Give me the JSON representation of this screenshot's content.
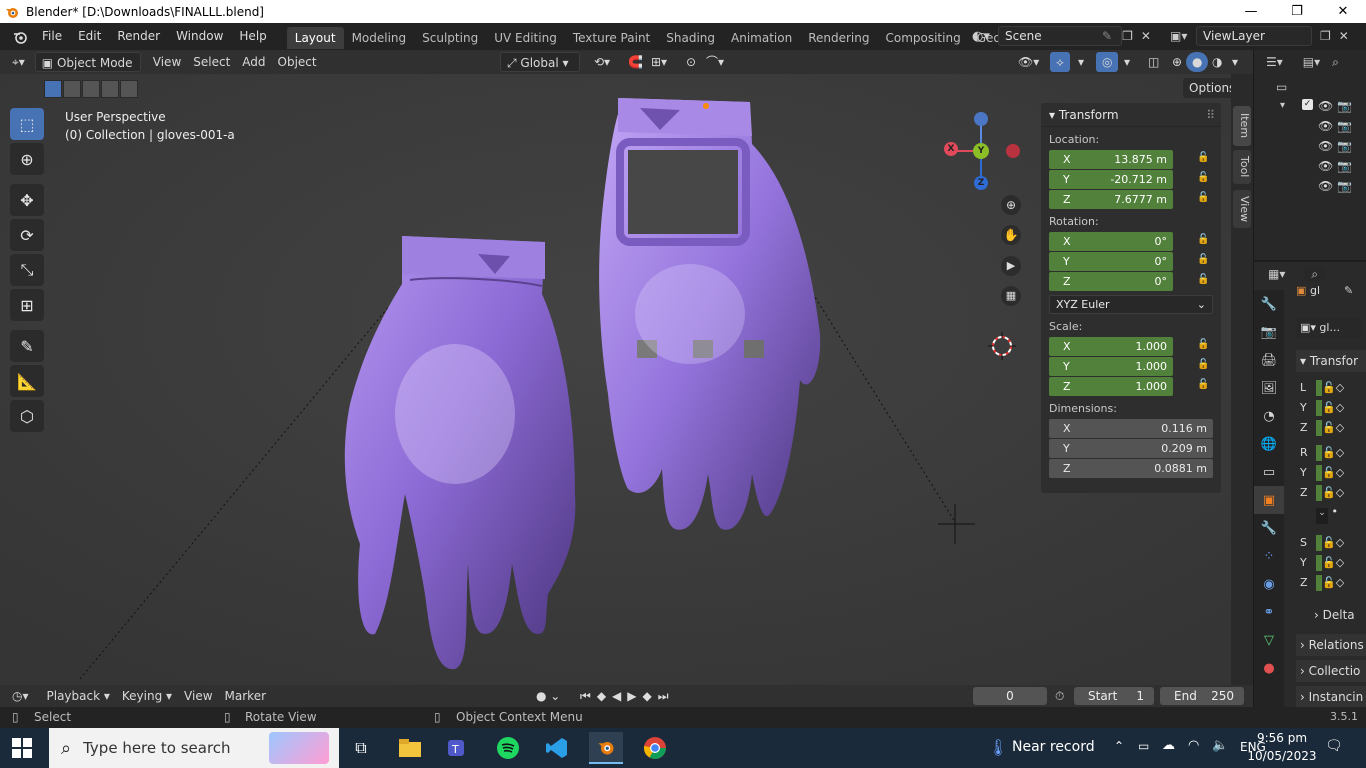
{
  "window": {
    "title": "Blender* [D:\\Downloads\\FINALLL.blend]",
    "minimize": "—",
    "maximize": "❐",
    "close": "✕"
  },
  "menubar": {
    "items": [
      "File",
      "Edit",
      "Render",
      "Window",
      "Help"
    ],
    "workspaces": [
      "Layout",
      "Modeling",
      "Sculpting",
      "UV Editing",
      "Texture Paint",
      "Shading",
      "Animation",
      "Rendering",
      "Compositing",
      "Geometry Noc"
    ],
    "active_workspace": "Layout",
    "scene": "Scene",
    "view_layer": "ViewLayer"
  },
  "viewport_header": {
    "mode": "Object Mode",
    "menus": [
      "View",
      "Select",
      "Add",
      "Object"
    ],
    "orientation": "Global",
    "options": "Options"
  },
  "viewport": {
    "info_line1": "User Perspective",
    "info_line2": "(0) Collection | gloves-001-a",
    "background": "#3d3d3d",
    "glove_color": "#8a6ad0"
  },
  "gizmo": {
    "x": "X",
    "y": "Y",
    "z": "Z"
  },
  "transform_panel": {
    "title": "Transform",
    "location_label": "Location:",
    "location": [
      {
        "axis": "X",
        "value": "13.875 m"
      },
      {
        "axis": "Y",
        "value": "-20.712 m"
      },
      {
        "axis": "Z",
        "value": "7.6777 m"
      }
    ],
    "rotation_label": "Rotation:",
    "rotation": [
      {
        "axis": "X",
        "value": "0°"
      },
      {
        "axis": "Y",
        "value": "0°"
      },
      {
        "axis": "Z",
        "value": "0°"
      }
    ],
    "rotation_mode": "XYZ Euler",
    "scale_label": "Scale:",
    "scale": [
      {
        "axis": "X",
        "value": "1.000"
      },
      {
        "axis": "Y",
        "value": "1.000"
      },
      {
        "axis": "Z",
        "value": "1.000"
      }
    ],
    "dimensions_label": "Dimensions:",
    "dimensions": [
      {
        "axis": "X",
        "value": "0.116 m"
      },
      {
        "axis": "Y",
        "value": "0.209 m"
      },
      {
        "axis": "Z",
        "value": "0.0881 m"
      }
    ]
  },
  "side_tabs": [
    "Item",
    "Tool",
    "View"
  ],
  "properties": {
    "search_value": "gl",
    "object_name": "gl...",
    "section": "Transfor",
    "rows": [
      "L",
      "Y",
      "Z",
      "R",
      "Y",
      "Z",
      "S",
      "Y",
      "Z"
    ],
    "subsections": [
      "Delta",
      "Relations",
      "Collectio",
      "Instancin"
    ]
  },
  "timeline": {
    "menus": [
      "Playback",
      "Keying",
      "View",
      "Marker"
    ],
    "current_frame": "0",
    "start_label": "Start",
    "start": "1",
    "end_label": "End",
    "end": "250"
  },
  "statusbar": {
    "select": "Select",
    "rotate": "Rotate View",
    "context": "Object Context Menu",
    "version": "3.5.1"
  },
  "taskbar": {
    "search_placeholder": "Type here to search",
    "weather": "Near record",
    "language": "ENG",
    "time": "9:56 pm",
    "date": "10/05/2023"
  }
}
